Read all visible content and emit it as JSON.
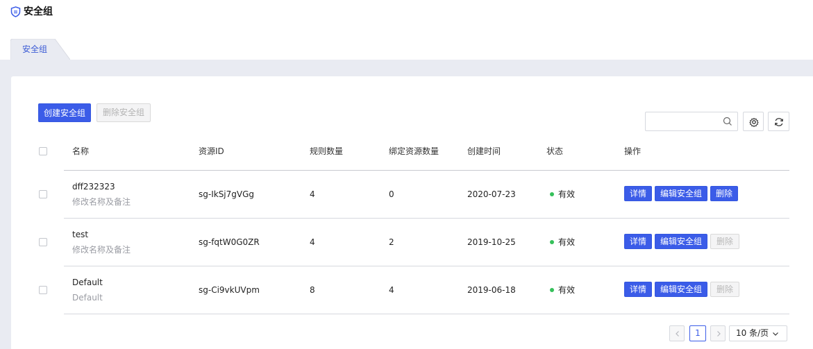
{
  "page": {
    "title": "安全组"
  },
  "tabs": [
    {
      "label": "安全组"
    }
  ],
  "toolbar": {
    "create_label": "创建安全组",
    "delete_label": "删除安全组",
    "search_placeholder": ""
  },
  "table": {
    "columns": [
      "名称",
      "资源ID",
      "规则数量",
      "绑定资源数量",
      "创建时间",
      "状态",
      "操作"
    ],
    "rows": [
      {
        "name": "dff232323",
        "note": "修改名称及备注",
        "id": "sg-IkSj7gVGg",
        "rules": "4",
        "bound": "0",
        "created": "2020-07-23",
        "status": "有效",
        "delete_enabled": true
      },
      {
        "name": "test",
        "note": "修改名称及备注",
        "id": "sg-fqtW0G0ZR",
        "rules": "4",
        "bound": "2",
        "created": "2019-10-25",
        "status": "有效",
        "delete_enabled": false
      },
      {
        "name": "Default",
        "note": "Default",
        "id": "sg-Ci9vkUVpm",
        "rules": "8",
        "bound": "4",
        "created": "2019-06-18",
        "status": "有效",
        "delete_enabled": false
      }
    ],
    "actions": {
      "detail": "详情",
      "edit": "编辑安全组",
      "delete": "删除"
    }
  },
  "pagination": {
    "current_page": "1",
    "page_size": "10 条/页"
  },
  "colors": {
    "primary": "#3b5ce8",
    "status_ok": "#35c05a",
    "background": "#e9ebf2"
  }
}
